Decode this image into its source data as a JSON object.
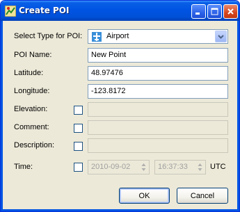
{
  "window": {
    "title": "Create POI",
    "icon": "poi-app-icon"
  },
  "titlebar_buttons": {
    "minimize": "minimize-icon",
    "maximize": "maximize-icon",
    "close": "close-icon"
  },
  "form": {
    "type": {
      "label": "Select Type for POI:",
      "value": "Airport",
      "icon": "airplane-icon"
    },
    "name": {
      "label": "POI Name:",
      "value": "New Point"
    },
    "latitude": {
      "label": "Latitude:",
      "value": "48.97476"
    },
    "longitude": {
      "label": "Longitude:",
      "value": "-123.8172"
    },
    "elevation": {
      "label": "Elevation:",
      "value": "",
      "checked": false
    },
    "comment": {
      "label": "Comment:",
      "value": "",
      "checked": false
    },
    "description": {
      "label": "Description:",
      "value": "",
      "checked": false
    },
    "time": {
      "label": "Time:",
      "date": "2010-09-02",
      "clock": "16:37:33",
      "zone": "UTC",
      "checked": false
    }
  },
  "buttons": {
    "ok": "OK",
    "cancel": "Cancel"
  },
  "colors": {
    "titlebar": "#0054e3",
    "dialog_bg": "#ece9d8",
    "field_border": "#7f9db9"
  }
}
